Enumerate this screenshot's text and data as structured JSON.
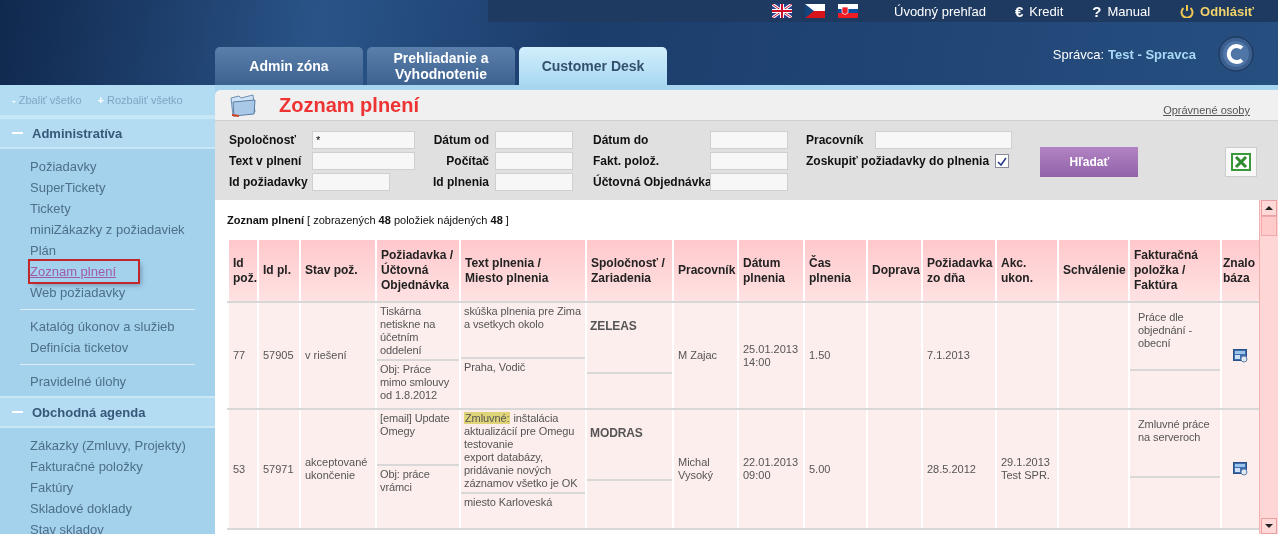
{
  "top_bar": {
    "languages": [
      {
        "kind": "en"
      },
      {
        "kind": "cz"
      },
      {
        "kind": "sk"
      }
    ],
    "links": [
      {
        "kind": "plain",
        "label": "Úvodný prehľad"
      },
      {
        "kind": "euro",
        "icon": "€",
        "label": "Kredit"
      },
      {
        "kind": "help",
        "icon": "?",
        "label": "Manual"
      },
      {
        "kind": "logout",
        "label": "Odhlásiť"
      }
    ]
  },
  "tabs": [
    {
      "label": "Admin zóna",
      "selected": false
    },
    {
      "label": "Prehliadanie a Vyhodnotenie",
      "selected": false
    },
    {
      "label": "Customer Desk",
      "selected": true
    }
  ],
  "user": {
    "label": "Správca:",
    "name": "Test - Spravca"
  },
  "sidebar": {
    "controls": [
      {
        "icon": "-",
        "label": "Zbaliť všetko"
      },
      {
        "icon": "+",
        "label": "Rozbaliť všetko"
      }
    ],
    "sections": [
      {
        "title": "Administratíva",
        "expanded": true,
        "groups": [
          [
            {
              "label": "Požiadavky",
              "selected": false
            },
            {
              "label": "SuperTickety",
              "selected": false
            },
            {
              "label": "Tickety",
              "selected": false
            },
            {
              "label": "miniZákazky z požiadaviek",
              "selected": false
            },
            {
              "label": "Plán",
              "selected": false
            },
            {
              "label": "Zoznam plnení",
              "selected": true
            },
            {
              "label": "Web požiadavky",
              "selected": false
            }
          ],
          [
            {
              "label": "Katalóg úkonov a služieb",
              "selected": false
            },
            {
              "label": "Definícia ticketov",
              "selected": false
            }
          ],
          [
            {
              "label": "Pravidelné úlohy",
              "selected": false
            }
          ]
        ]
      },
      {
        "title": "Obchodná agenda",
        "expanded": true,
        "groups": [
          [
            {
              "label": "Zákazky (Zmluvy, Projekty)",
              "selected": false
            },
            {
              "label": "Fakturačné položky",
              "selected": false
            },
            {
              "label": "Faktúry",
              "selected": false
            },
            {
              "label": "Skladové doklady",
              "selected": false
            },
            {
              "label": "Stav skladov",
              "selected": false
            }
          ]
        ]
      }
    ]
  },
  "page": {
    "title": "Zoznam plnení",
    "link": "Oprávnené osoby"
  },
  "filters": {
    "columns": [
      [
        {
          "label": "Spoločnosť",
          "value": "*"
        },
        {
          "label": "Text v plnení"
        },
        {
          "label": "Id požiadavky"
        }
      ],
      [
        {
          "label": "Dátum od"
        },
        {
          "label": "Počítač"
        },
        {
          "label": "Id plnenia"
        }
      ],
      [
        {
          "label": "Dátum do"
        },
        {
          "label": "Fakt. polož."
        },
        {
          "label": "Účtovná Objednávka"
        }
      ]
    ],
    "worker": {
      "label": "Pracovník"
    },
    "group_checkbox": {
      "label": "Zoskupiť požiadavky do plnenia",
      "checked": true
    },
    "search_button": "Hľadať"
  },
  "summary": "**Zoznam plnení** [ zobrazených **48** položiek nájdených **48** ]",
  "table": {
    "columns": [
      "Id pož.",
      "Id pl.",
      "Stav pož.",
      "Požiadavka / Účtovná Objednávka",
      "Text plnenia / Miesto plnenia",
      "Spoločnosť / Zariadenia",
      "Pracovník",
      "Dátum plnenia",
      "Čas plnenia",
      "Doprava",
      "Požiadavka zo dňa",
      "Akc. ukon.",
      "Schválenie",
      "Fakturačná položka / Faktúra",
      "Znalo báza"
    ],
    "rows": [
      {
        "cells": [
          {
            "text": "77"
          },
          {
            "text": "57905"
          },
          {
            "text": "v riešení"
          },
          {
            "split": [
              "Tiskárna netiskne na účetním oddelení",
              "Obj: Práce mimo smlouvy od 1.8.2012"
            ]
          },
          {
            "split": [
              "skúška plnenia pre Zima a vsetkych okolo",
              "Praha, Vodič"
            ]
          },
          {
            "split": [
              "ZELEAS"
            ]
          },
          {
            "text": "M Zajac"
          },
          {
            "text": "25.01.2013 14:00"
          },
          {
            "text": "1.50"
          },
          {},
          {
            "text": "7.1.2013"
          },
          {},
          {},
          {
            "split": [
              "Práce dle objednání - obecní"
            ]
          },
          {
            "kind": "kb-icon"
          }
        ]
      },
      {
        "cells": [
          {
            "text": "53"
          },
          {
            "text": "57971"
          },
          {
            "text": "akceptované ukončenie"
          },
          {
            "split": [
              "[email] Update Omegy",
              "Obj: práce vrámci"
            ]
          },
          {
            "tag": "Zmluvné:",
            "split": [
              "inštalácia aktualizácií pre Omegu testovanie\nexport databázy, pridávanie nových záznamov všetko je OK",
              "miesto Karloveská"
            ]
          },
          {
            "split": [
              "MODRAS"
            ]
          },
          {
            "text": "Michal Vysoký"
          },
          {
            "text": "22.01.2013 09:00"
          },
          {
            "text": "5.00"
          },
          {},
          {
            "text": "28.5.2012"
          },
          {
            "text": "29.1.2013 Test SPR."
          },
          {},
          {
            "split": [
              "Zmluvné práce na serveroch"
            ]
          },
          {
            "kind": "kb-icon"
          }
        ]
      }
    ]
  }
}
